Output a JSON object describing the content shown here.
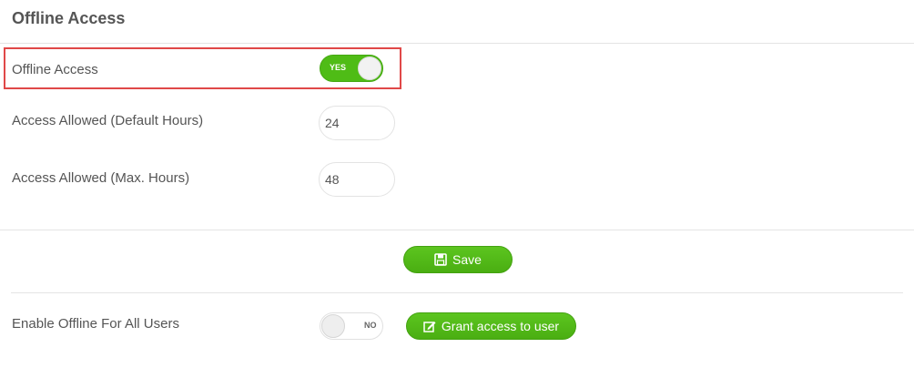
{
  "header": {
    "title": "Offline Access"
  },
  "offline_access": {
    "label": "Offline Access",
    "toggle_text": "YES",
    "enabled": true
  },
  "default_hours": {
    "label": "Access Allowed (Default Hours)",
    "value": "24"
  },
  "max_hours": {
    "label": "Access Allowed (Max. Hours)",
    "value": "48"
  },
  "save_button": {
    "label": "Save",
    "icon": "floppy-disk-icon"
  },
  "enable_all": {
    "label": "Enable Offline For All Users",
    "toggle_text": "NO",
    "enabled": false
  },
  "grant_button": {
    "label": "Grant access to user",
    "icon": "edit-icon"
  },
  "colors": {
    "accent": "#4fbc16",
    "highlight": "#e04848",
    "text": "#555555"
  }
}
